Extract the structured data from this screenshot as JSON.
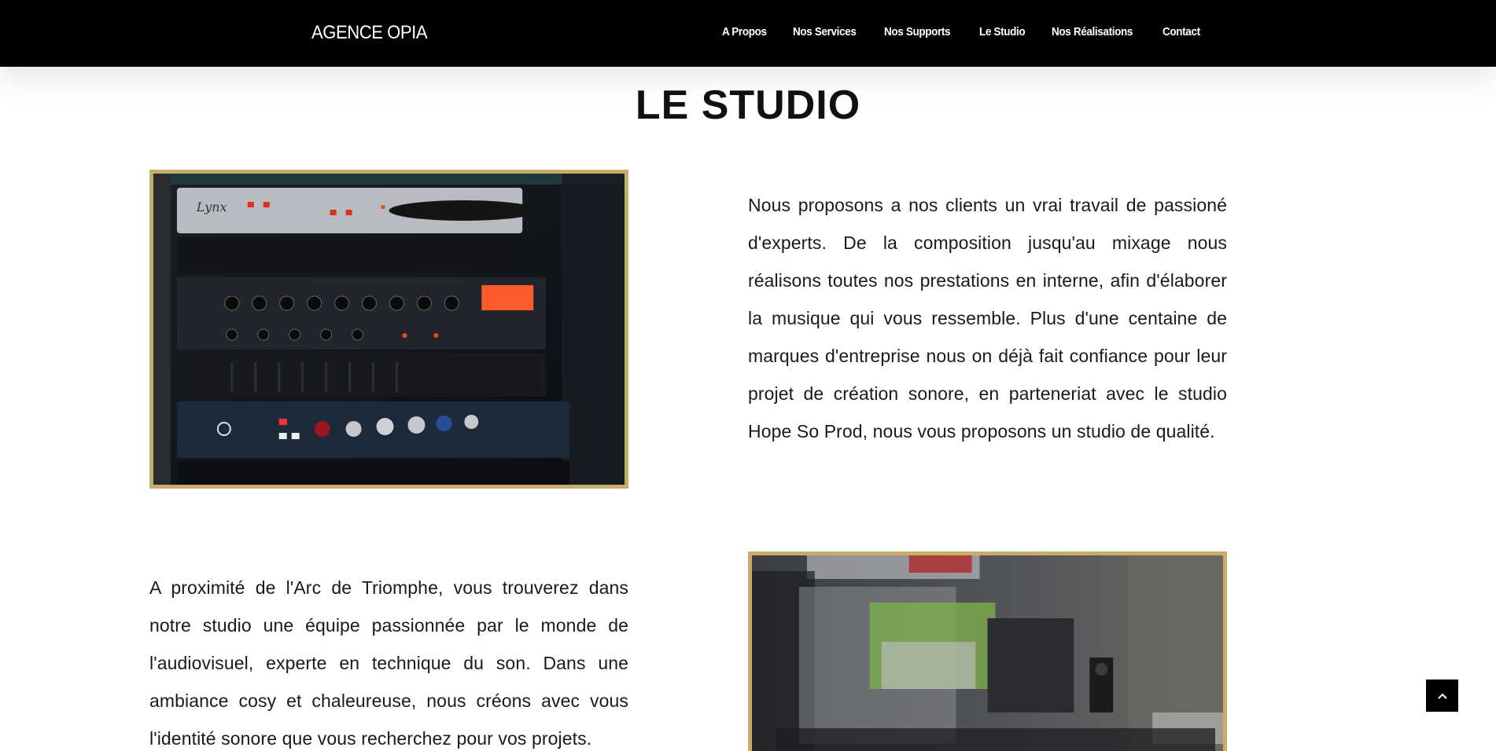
{
  "header": {
    "brand": "AGENCE OPIA",
    "nav": [
      "A Propos",
      "Nos Services",
      "Nos Supports",
      "Le Studio",
      "Nos Réalisations",
      "Contact"
    ]
  },
  "main": {
    "title": "LE STUDIO",
    "paragraph_1": "Nous proposons a nos clients un vrai travail de passioné d'experts. De la composition jusqu'au mixage nous réalisons toutes nos prestations en interne, afin d'élaborer la musique qui vous ressemble. Plus d'une centaine de marques d'entreprise nous on déjà fait confiance pour leur projet de création sonore, en parteneriat avec le studio Hope So Prod, nous vous proposons un studio de qualité.",
    "paragraph_2": "A proximité de l'Arc de Triomphe, vous trouverez dans notre studio une équipe passionnée par le monde de l'audiovisuel, experte en technique du son. Dans une ambiance cosy et chaleureuse, nous créons avec vous l'identité sonore que vous recherchez pour vos projets."
  },
  "colors": {
    "nav_background": "#000000",
    "photo_border": "#c8ad68"
  },
  "icons": {
    "back_to_top": "chevron-up-icon"
  }
}
